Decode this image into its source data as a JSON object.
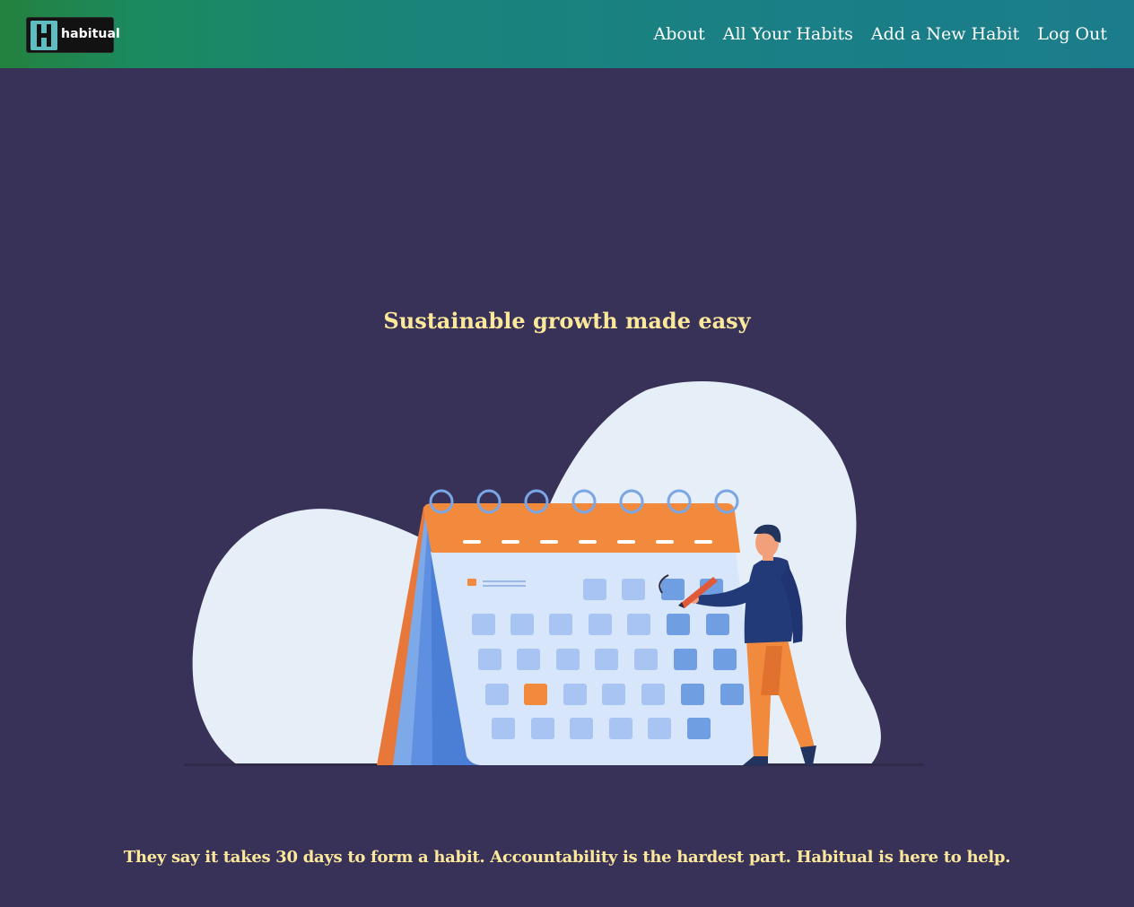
{
  "brand": {
    "logo_text": "habitual",
    "logo_letter": "H"
  },
  "nav": {
    "items": [
      {
        "label": "About"
      },
      {
        "label": "All Your Habits"
      },
      {
        "label": "Add a New Habit"
      },
      {
        "label": "Log Out"
      }
    ]
  },
  "hero": {
    "headline": "Sustainable growth made easy",
    "illustration_icon": "calendar-illustration-icon",
    "tagline": "They say it takes 30 days to form a habit. Accountability is the hardest part. Habitual is here to help."
  },
  "colors": {
    "page_background": "#383258",
    "accent_text": "#fbe89a",
    "nav_gradient_start": "#24813e",
    "nav_gradient_end": "#1b7d8b",
    "calendar_orange": "#f28a3d",
    "calendar_blue": "#5b8bdc"
  }
}
